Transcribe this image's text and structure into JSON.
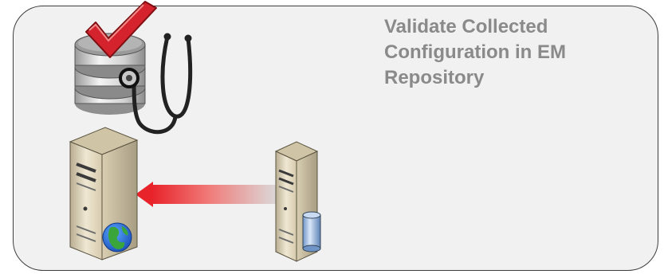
{
  "title_lines": [
    "Validate Collected",
    "Configuration in EM",
    "Repository"
  ],
  "icons": {
    "repository": "database-checkmark-icon",
    "stethoscope": "stethoscope-icon",
    "source_server": "web-server-globe-icon",
    "target_server": "database-server-icon",
    "flow_arrow": "arrow-left-icon"
  },
  "colors": {
    "panel_bg": "#f1f1f1",
    "panel_border": "#3d3d3d",
    "title_text": "#8a8a8a",
    "checkmark": "#d4232c",
    "arrow_head": "#e8232a",
    "server_body": "#e6dcc2"
  }
}
